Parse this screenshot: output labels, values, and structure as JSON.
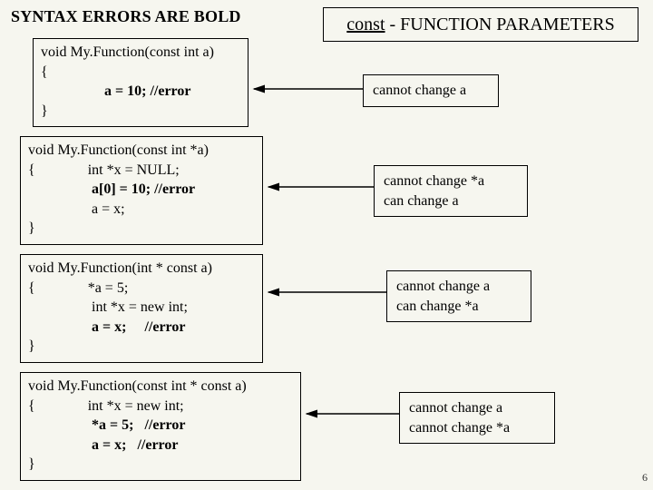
{
  "heading": "SYNTAX ERRORS ARE BOLD",
  "title": {
    "prefix": "const",
    "rest": " - FUNCTION PARAMETERS"
  },
  "page_number": "6",
  "code1": {
    "sig": "void My.Function(const int a)",
    "open": "{",
    "body1a": "a = 10; ",
    "body1b": "//error",
    "close": "}"
  },
  "code2": {
    "sig": "void My.Function(const int *a)",
    "open": "{",
    "l1": "int *x = NULL;",
    "l2a": "a[0] = 10; ",
    "l2b": "//error",
    "l3": "a = x;",
    "close": "}"
  },
  "code3": {
    "sig": "void My.Function(int * const a)",
    "open": "{",
    "l1": "*a = 5;",
    "l2": "int *x = new int;",
    "l3a": "a = x;     ",
    "l3b": "//error",
    "close": "}"
  },
  "code4": {
    "sig": "void My.Function(const int * const a)",
    "open": "{",
    "l1": "int *x = new int;",
    "l2a": "*a = 5;   ",
    "l2b": "//error",
    "l3a": "a = x;   ",
    "l3b": "//error",
    "close": "}"
  },
  "note1": {
    "l1": "cannot change a"
  },
  "note2": {
    "l1": "cannot change *a",
    "l2": "can change a"
  },
  "note3": {
    "l1": "cannot change a",
    "l2": "can change *a"
  },
  "note4": {
    "l1": "cannot change a",
    "l2": "cannot change *a"
  }
}
